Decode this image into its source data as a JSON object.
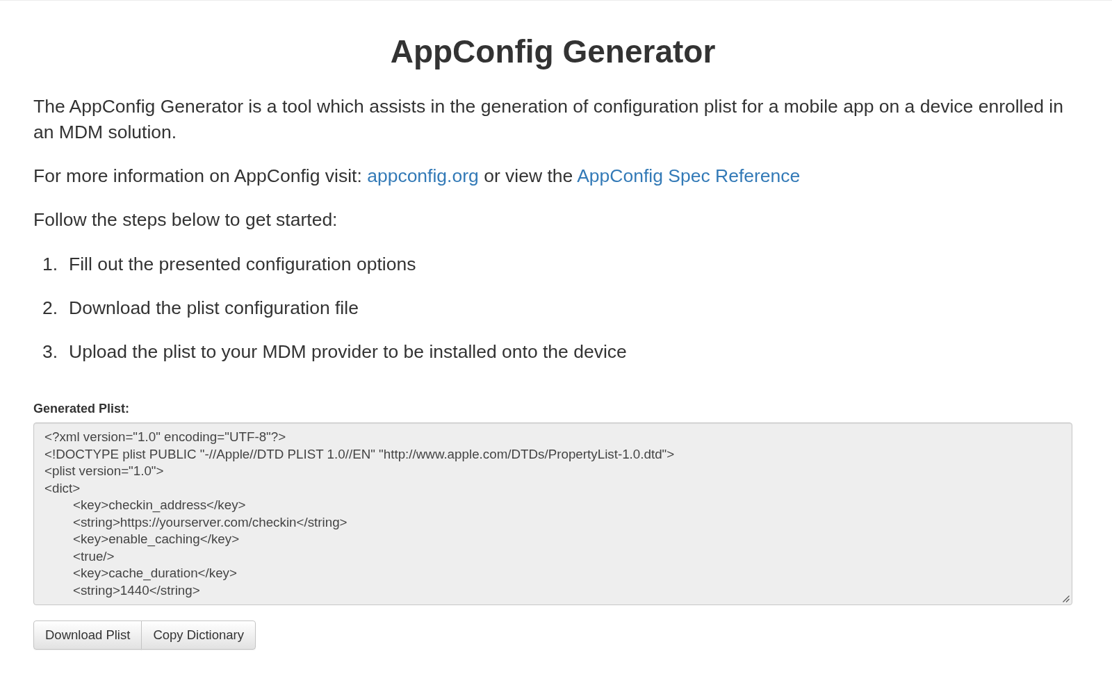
{
  "page": {
    "title": "AppConfig Generator"
  },
  "intro": "The AppConfig Generator is a tool which assists in the generation of configuration plist for a mobile app on a device enrolled in an MDM solution.",
  "info": [
    {
      "kind": "text",
      "text": "For more information on AppConfig visit:"
    },
    {
      "kind": "link",
      "text": "appconfig.org"
    },
    {
      "kind": "text",
      "text": "or view the"
    },
    {
      "kind": "link",
      "text": "AppConfig Spec Reference"
    }
  ],
  "steps_intro": "Follow the steps below to get started:",
  "steps": [
    {
      "number": "1.",
      "text": "Fill out the presented configuration options"
    },
    {
      "number": "2.",
      "text": "Download the plist configuration file"
    },
    {
      "number": "3.",
      "text": "Upload the plist to your MDM provider to be installed onto the device"
    }
  ],
  "generated_plist": {
    "label": "Generated Plist:",
    "value": "<?xml version=\"1.0\" encoding=\"UTF-8\"?>\n<!DOCTYPE plist PUBLIC \"-//Apple//DTD PLIST 1.0//EN\" \"http://www.apple.com/DTDs/PropertyList-1.0.dtd\">\n<plist version=\"1.0\">\n<dict>\n\t<key>checkin_address</key>\n\t<string>https://yourserver.com/checkin</string>\n\t<key>enable_caching</key>\n\t<true/>\n\t<key>cache_duration</key>\n\t<string>1440</string>"
  },
  "buttons": [
    {
      "label": "Download Plist"
    },
    {
      "label": "Copy Dictionary"
    }
  ]
}
